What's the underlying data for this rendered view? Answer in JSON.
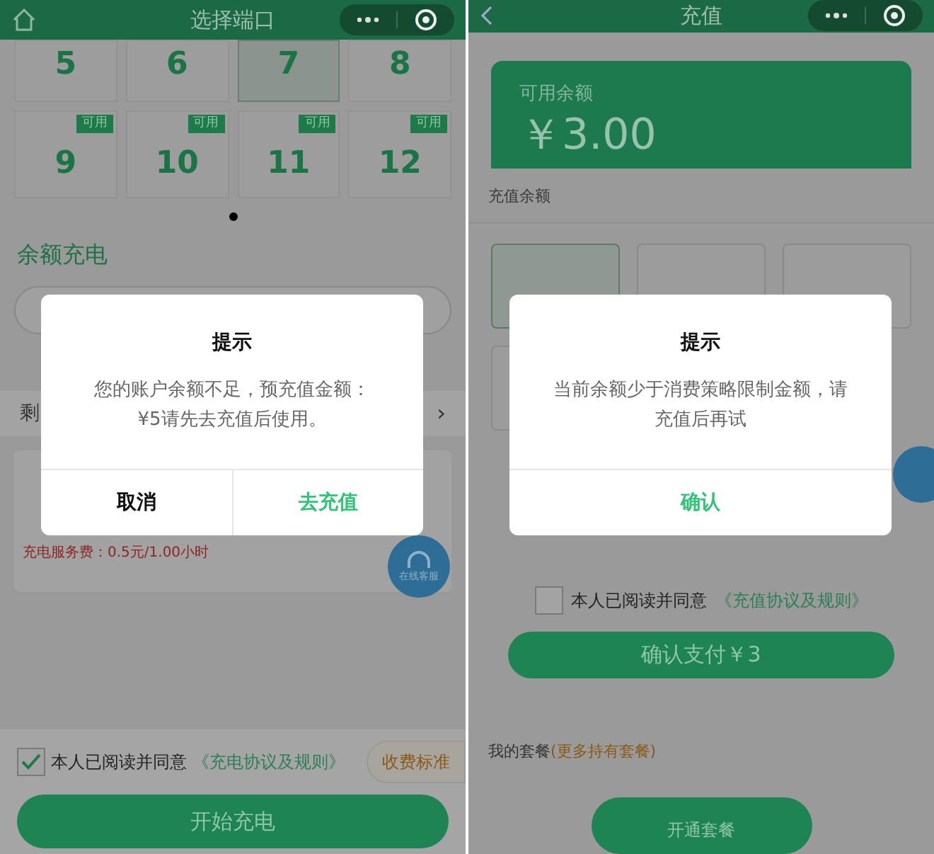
{
  "port_screen": {
    "title": "选择端口",
    "ports": [
      {
        "number": "5",
        "available": false,
        "selected": false
      },
      {
        "number": "6",
        "available": false,
        "selected": false
      },
      {
        "number": "7",
        "available": false,
        "selected": true
      },
      {
        "number": "8",
        "available": false,
        "selected": false
      },
      {
        "number": "9",
        "available": true,
        "badge": "可用",
        "selected": false
      },
      {
        "number": "10",
        "available": true,
        "badge": "可用",
        "selected": false
      },
      {
        "number": "11",
        "available": true,
        "badge": "可用",
        "selected": false
      },
      {
        "number": "12",
        "available": true,
        "badge": "可用",
        "selected": false
      }
    ],
    "section_title": "余额充电",
    "row_left": "剩",
    "row_right": "›",
    "fee": "充电服务费：0.5元/1.00小时",
    "service_label": "在线客服",
    "agreement": {
      "checked": true,
      "text": "本人已阅读并同意",
      "link": "《充电协议及规则》"
    },
    "pricing_button": "收费标准",
    "start_button": "开始充电",
    "dialog": {
      "title": "提示",
      "message": "您的账户余额不足，预充值金额：¥5请先去充值后使用。",
      "buttons": [
        {
          "label": "取消",
          "kind": "cancel"
        },
        {
          "label": "去充值",
          "kind": "primary"
        }
      ]
    }
  },
  "recharge_screen": {
    "title": "充值",
    "balance_label": "可用余额",
    "balance": "￥3.00",
    "section_title": "充值余额",
    "options": [
      {
        "selected": true
      },
      {
        "selected": false
      },
      {
        "selected": false
      },
      {
        "selected": false
      }
    ],
    "agreement": {
      "checked": false,
      "text": "本人已阅读并同意",
      "link": "《充值协议及规则》"
    },
    "pay_button": "确认支付￥3",
    "packages_label": "我的套餐",
    "packages_link": "(更多持有套餐)",
    "open_button": "开通套餐",
    "dialog": {
      "title": "提示",
      "message": "当前余额少于消费策略限制金额，请充值后再试",
      "buttons": [
        {
          "label": "确认",
          "kind": "primary"
        }
      ]
    }
  }
}
